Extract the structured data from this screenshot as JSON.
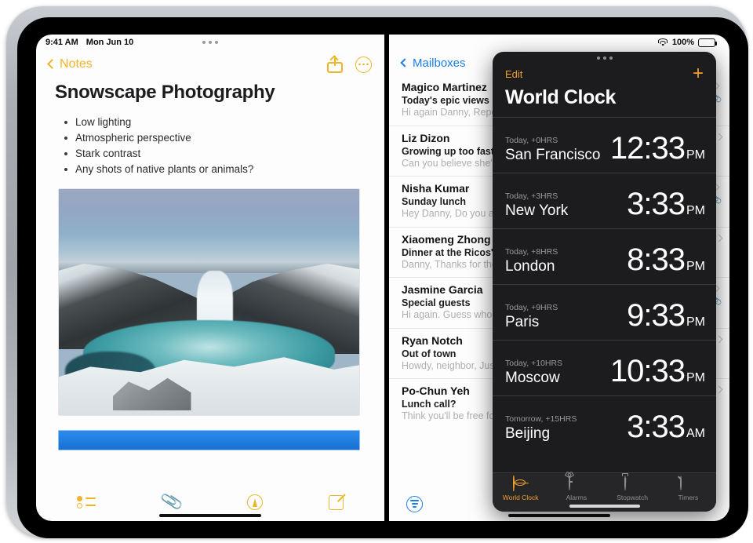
{
  "notes": {
    "status": {
      "time": "9:41 AM",
      "date": "Mon Jun 10"
    },
    "nav": {
      "back_label": "Notes",
      "share_icon": "share-icon",
      "more_icon": "more-options-icon"
    },
    "title": "Snowscape Photography",
    "bullets": [
      "Low lighting",
      "Atmospheric perspective",
      "Stark contrast",
      "Any shots of native plants or animals?"
    ],
    "photo_alt": "Snow covered waterfall landscape",
    "toolbar": [
      {
        "name": "checklist-button",
        "icon": "checklist-icon"
      },
      {
        "name": "attachment-button",
        "icon": "paperclip-icon"
      },
      {
        "name": "markup-button",
        "icon": "markup-pen-icon"
      },
      {
        "name": "compose-button",
        "icon": "compose-icon"
      }
    ]
  },
  "mail": {
    "status": {
      "battery_percent": "100%",
      "wifi_icon": "wifi-icon",
      "battery_icon": "battery-icon"
    },
    "nav": {
      "back_label": "Mailboxes"
    },
    "messages": [
      {
        "sender": "Magico Martinez",
        "subject": "Today's epic views",
        "preview": "Hi again Danny, Report Wide open skies, a gen",
        "has_attachment": true
      },
      {
        "sender": "Liz Dizon",
        "subject": "Growing up too fast!",
        "preview": "Can you believe she's a",
        "has_attachment": false
      },
      {
        "sender": "Nisha Kumar",
        "subject": "Sunday lunch",
        "preview": "Hey Danny, Do you and dad? If you two join, th",
        "has_attachment": true
      },
      {
        "sender": "Xiaomeng Zhong",
        "subject": "Dinner at the Ricos'",
        "preview": "Danny, Thanks for the a remembered to take on",
        "has_attachment": false
      },
      {
        "sender": "Jasmine Garcia",
        "subject": "Special guests",
        "preview": "Hi again. Guess who's know how to make me",
        "has_attachment": true
      },
      {
        "sender": "Ryan Notch",
        "subject": "Out of town",
        "preview": "Howdy, neighbor, Just leaving Tuesday and w",
        "has_attachment": true
      },
      {
        "sender": "Po-Chun Yeh",
        "subject": "Lunch call?",
        "preview": "Think you'll be free for you think might work a",
        "has_attachment": false
      }
    ],
    "toolbar": {
      "filter_icon": "filter-icon"
    }
  },
  "world_clock": {
    "edit_label": "Edit",
    "add_label": "+",
    "title": "World Clock",
    "accent_color": "#f0a02a",
    "clocks": [
      {
        "offset": "Today, +0HRS",
        "city": "San Francisco",
        "time": "12:33",
        "meridiem": "PM"
      },
      {
        "offset": "Today, +3HRS",
        "city": "New York",
        "time": "3:33",
        "meridiem": "PM"
      },
      {
        "offset": "Today, +8HRS",
        "city": "London",
        "time": "8:33",
        "meridiem": "PM"
      },
      {
        "offset": "Today, +9HRS",
        "city": "Paris",
        "time": "9:33",
        "meridiem": "PM"
      },
      {
        "offset": "Today, +10HRS",
        "city": "Moscow",
        "time": "10:33",
        "meridiem": "PM"
      },
      {
        "offset": "Tomorrow, +15HRS",
        "city": "Beijing",
        "time": "3:33",
        "meridiem": "AM"
      }
    ],
    "tabs": [
      {
        "label": "World Clock",
        "icon": "globe-icon",
        "active": true
      },
      {
        "label": "Alarms",
        "icon": "alarm-icon",
        "active": false
      },
      {
        "label": "Stopwatch",
        "icon": "stopwatch-icon",
        "active": false
      },
      {
        "label": "Timers",
        "icon": "timer-icon",
        "active": false
      }
    ]
  }
}
